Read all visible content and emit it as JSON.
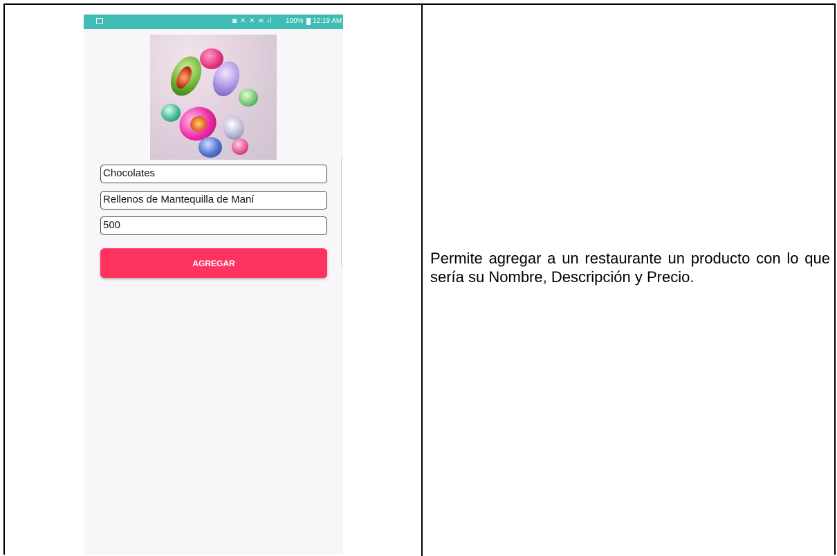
{
  "status_bar": {
    "icons": "◙ ✕ ✕ ≋ ıl",
    "battery": "100%",
    "time": "12:19 AM"
  },
  "product_image": {
    "icon": "chocolate-eggs-image"
  },
  "form": {
    "name_value": "Chocolates",
    "description_value": "Rellenos de Mantequilla de Maní",
    "price_value": "500",
    "submit_label": "AGREGAR"
  },
  "description_text": "Permite agregar a un restaurante un producto con lo que sería su Nombre, Descripción y Precio.",
  "colors": {
    "status_bar": "#3fbdb5",
    "button": "#ff3360",
    "screen_bg": "#f8f6f9"
  }
}
